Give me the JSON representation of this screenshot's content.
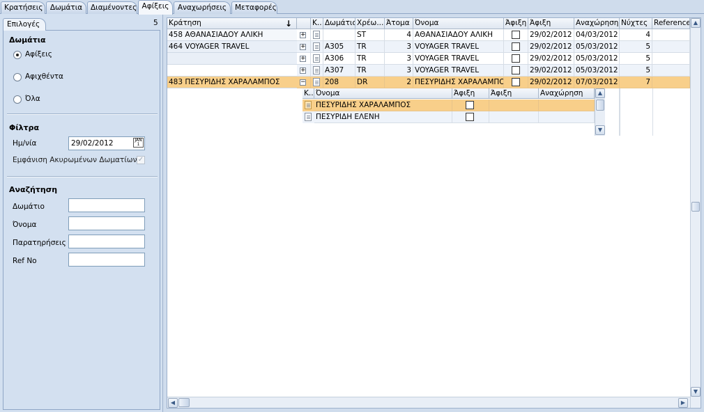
{
  "tabs": [
    {
      "label": "Κρατήσεις"
    },
    {
      "label": "Δωμάτια"
    },
    {
      "label": "Διαμένοντες"
    },
    {
      "label": "Αφίξεις"
    },
    {
      "label": "Αναχωρήσεις"
    },
    {
      "label": "Μεταφορές"
    }
  ],
  "left": {
    "tab_label": "Επιλογές",
    "count": "5",
    "rooms_title": "Δωμάτια",
    "radios": [
      {
        "label": "Αφίξεις",
        "checked": true
      },
      {
        "label": "Αφιχθέντα",
        "checked": false
      },
      {
        "label": "Όλα",
        "checked": false
      }
    ],
    "filters_title": "Φίλτρα",
    "date_label": "Ημ/νία",
    "date_value": "29/02/2012",
    "cancelled_label": "Εμφάνιση Ακυρωμένων Δωματίων",
    "search_title": "Αναζήτηση",
    "search_fields": [
      {
        "label": "Δωμάτιο",
        "value": ""
      },
      {
        "label": "Όνομα",
        "value": ""
      },
      {
        "label": "Παρατηρήσεις",
        "value": ""
      },
      {
        "label": "Ref No",
        "value": ""
      }
    ]
  },
  "grid": {
    "group_header": "Κράτηση",
    "columns": [
      "Κ..",
      "Δωμάτιο",
      "Χρέω...",
      "Άτομα",
      "Όνομα",
      "Άφιξη",
      "Άφιξη",
      "Αναχώρηση",
      "Νύχτες",
      "Reference"
    ],
    "groups": [
      "458 ΑΘΑΝΑΣΙΑΔΟΥ ΑΛΙΚΗ",
      "464 VOYAGER TRAVEL",
      "",
      "",
      "483 ΠΕΣΥΡΙΔΗΣ ΧΑΡΑΛΑΜΠΟΣ"
    ],
    "rows": [
      {
        "expander": "+",
        "room": "",
        "charge": "ST",
        "persons": "4",
        "name": "ΑΘΑΝΑΣΙΑΔΟΥ ΑΛΙΚΗ",
        "arrival": "29/02/2012",
        "departure": "04/03/2012",
        "nights": "4",
        "ref": ""
      },
      {
        "expander": "+",
        "room": "A305",
        "charge": "TR",
        "persons": "3",
        "name": "VOYAGER TRAVEL",
        "arrival": "29/02/2012",
        "departure": "05/03/2012",
        "nights": "5",
        "ref": ""
      },
      {
        "expander": "+",
        "room": "A306",
        "charge": "TR",
        "persons": "3",
        "name": "VOYAGER TRAVEL",
        "arrival": "29/02/2012",
        "departure": "05/03/2012",
        "nights": "5",
        "ref": ""
      },
      {
        "expander": "+",
        "room": "A307",
        "charge": "TR",
        "persons": "3",
        "name": "VOYAGER TRAVEL",
        "arrival": "29/02/2012",
        "departure": "05/03/2012",
        "nights": "5",
        "ref": ""
      },
      {
        "expander": "−",
        "room": "208",
        "charge": "DR",
        "persons": "2",
        "name": "ΠΕΣΥΡΙΔΗΣ ΧΑΡΑΛΑΜΠΟΣ",
        "arrival": "29/02/2012",
        "departure": "07/03/2012",
        "nights": "7",
        "ref": ""
      }
    ],
    "sub": {
      "columns": [
        "Κ..",
        "Όνομα",
        "Άφιξη",
        "Άφιξη",
        "Αναχώρηση"
      ],
      "rows": [
        {
          "name": "ΠΕΣΥΡΙΔΗΣ ΧΑΡΑΛΑΜΠΟΣ"
        },
        {
          "name": "ΠΕΣΥΡΙΔΗ ΕΛΕΝΗ"
        }
      ]
    }
  },
  "colors": {
    "selected_row": "#f8cf8a",
    "panel": "#d3e0f0"
  },
  "icons": {
    "sort": "sort-down-arrow-icon",
    "calendar": "calendar-icon",
    "doc": "document-icon",
    "checkbox": "checkbox-icon"
  }
}
